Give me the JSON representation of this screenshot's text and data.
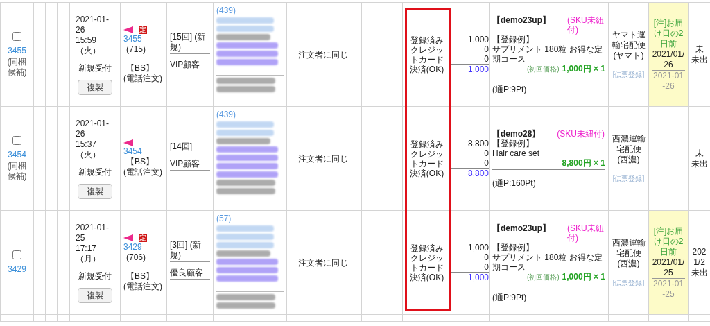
{
  "rows": [
    {
      "checked": false,
      "id": "3455",
      "bundle": "(同梱候補)",
      "date": "2021-01-26",
      "time": "15:59（火）",
      "status": "新規受付",
      "copy_button": "複製",
      "badge": "定",
      "order_no": "3455",
      "count": "(715)",
      "channel": "【BS】",
      "order_type": "(電話注文)",
      "ranks": [
        "[15回] (新規)",
        "VIP顧客"
      ],
      "customer_count": "(439)",
      "redacted": [
        {
          "kind": "name"
        },
        {
          "kind": "name"
        },
        {
          "kind": "phone"
        },
        {
          "kind": "address"
        },
        {
          "kind": "address"
        },
        {
          "kind": "address"
        },
        {
          "kind": "gap"
        },
        {
          "kind": "email"
        },
        {
          "kind": "email"
        }
      ],
      "ship_to": "注文者に同じ",
      "payment": "登録済みクレジットカード決済(OK)",
      "amounts": [
        "1,000",
        "0",
        "0"
      ],
      "total": "1,000",
      "product": {
        "code": "【demo23up】",
        "sku": "(SKU未紐付)",
        "label": "【登録例】",
        "name": "サプリメント 180粒 お得な定期コース",
        "price_note": "(初回価格)",
        "price": "1,000円 × 1",
        "points": "(通P:9Pt)"
      },
      "carrier": "ヤマト運輸宅配便(ヤマト)",
      "slip": "[伝票登録]",
      "delivery": {
        "highlighted": true,
        "note": "[注]お届け日の2日前",
        "date": "2021/01/26",
        "sub": "2021-01-26"
      },
      "last": [
        "未",
        "未出"
      ]
    },
    {
      "checked": false,
      "id": "3454",
      "bundle": "(同梱候補)",
      "date": "2021-01-26",
      "time": "15:37（火）",
      "status": "新規受付",
      "copy_button": "複製",
      "order_no": "3454",
      "channel": "【BS】",
      "order_type": "(電話注文)",
      "ranks": [
        "[14回]",
        "VIP顧客"
      ],
      "customer_count": "(439)",
      "redacted": [
        {
          "kind": "name"
        },
        {
          "kind": "name"
        },
        {
          "kind": "phone"
        },
        {
          "kind": "address"
        },
        {
          "kind": "address"
        },
        {
          "kind": "address"
        },
        {
          "kind": "address"
        },
        {
          "kind": "email"
        },
        {
          "kind": "email"
        }
      ],
      "ship_to": "注文者に同じ",
      "payment": "登録済みクレジットカード決済(OK)",
      "amounts": [
        "8,800",
        "0",
        "0"
      ],
      "total": "8,800",
      "product": {
        "code": "【demo28】",
        "sku": "(SKU未紐付)",
        "label": "【登録例】",
        "name": "Hair care set",
        "price": "8,800円 × 1",
        "points": "(通P:160Pt)"
      },
      "carrier": "西濃運輸宅配便(西濃)",
      "slip": "[伝票登録]",
      "last": [
        "未",
        "未出"
      ]
    },
    {
      "checked": false,
      "id": "3429",
      "date": "2021-01-25",
      "time": "17:17（月）",
      "status": "新規受付",
      "copy_button": "複製",
      "badge": "定",
      "order_no": "3429",
      "count": "(706)",
      "channel": "【BS】",
      "order_type": "(電話注文)",
      "ranks": [
        "[3回] (新規)",
        "優良顧客"
      ],
      "customer_count": "(57)",
      "redacted": [
        {
          "kind": "name"
        },
        {
          "kind": "name"
        },
        {
          "kind": "name"
        },
        {
          "kind": "phone"
        },
        {
          "kind": "address"
        },
        {
          "kind": "address"
        },
        {
          "kind": "address"
        },
        {
          "kind": "gap"
        },
        {
          "kind": "email"
        },
        {
          "kind": "email"
        }
      ],
      "ship_to": "注文者に同じ",
      "payment": "登録済みクレジットカード決済(OK)",
      "amounts": [
        "1,000",
        "0",
        "0"
      ],
      "total": "1,000",
      "product": {
        "code": "【demo23up】",
        "sku": "(SKU未紐付)",
        "label": "【登録例】",
        "name": "サプリメント 180粒 お得な定期コース",
        "price_note": "(初回価格)",
        "price": "1,000円 × 1",
        "points": "(通P:9Pt)"
      },
      "carrier": "西濃運輸宅配便(西濃)",
      "slip": "[伝票登録]",
      "delivery": {
        "highlighted": true,
        "note": "[注]お届け日の2日前",
        "date": "2021/01/25",
        "sub": "2021-01-25"
      },
      "last": [
        "202",
        "1/2",
        "未出"
      ]
    }
  ]
}
